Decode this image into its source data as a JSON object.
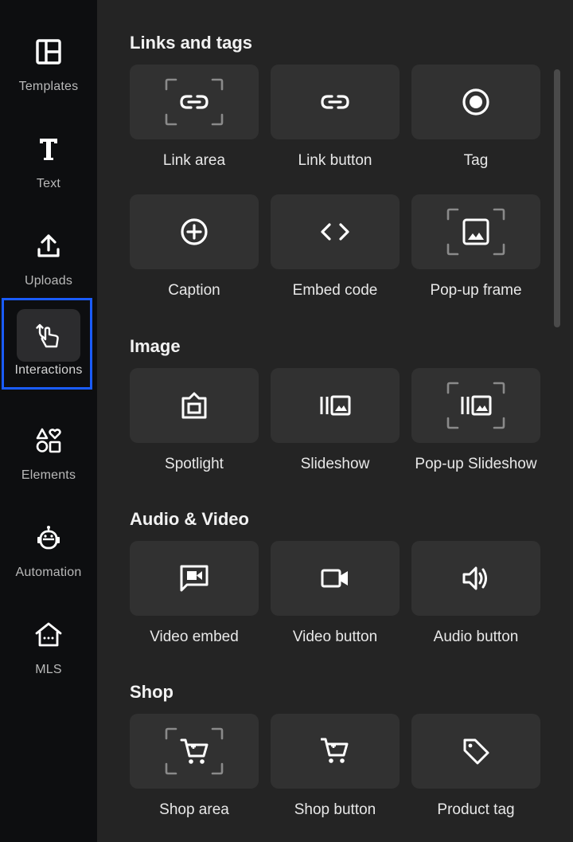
{
  "sidebar": {
    "items": [
      {
        "label": "Templates",
        "icon": "templates-icon"
      },
      {
        "label": "Text",
        "icon": "text-icon"
      },
      {
        "label": "Uploads",
        "icon": "upload-icon"
      },
      {
        "label": "Interactions",
        "icon": "interactions-icon",
        "active": true
      },
      {
        "label": "Elements",
        "icon": "elements-icon"
      },
      {
        "label": "Automation",
        "icon": "robot-icon"
      },
      {
        "label": "MLS",
        "icon": "house-icon"
      }
    ]
  },
  "sections": [
    {
      "title": "Links and tags",
      "items": [
        {
          "label": "Link area",
          "icon": "link-area-icon"
        },
        {
          "label": "Link button",
          "icon": "link-icon"
        },
        {
          "label": "Tag",
          "icon": "tag-dot-icon"
        },
        {
          "label": "Caption",
          "icon": "plus-circle-icon"
        },
        {
          "label": "Embed code",
          "icon": "code-icon"
        },
        {
          "label": "Pop-up frame",
          "icon": "popup-frame-icon"
        }
      ]
    },
    {
      "title": "Image",
      "items": [
        {
          "label": "Spotlight",
          "icon": "spotlight-icon"
        },
        {
          "label": "Slideshow",
          "icon": "slideshow-icon"
        },
        {
          "label": "Pop-up Slideshow",
          "icon": "popup-slideshow-icon"
        }
      ]
    },
    {
      "title": "Audio & Video",
      "items": [
        {
          "label": "Video embed",
          "icon": "video-embed-icon"
        },
        {
          "label": "Video button",
          "icon": "video-camera-icon"
        },
        {
          "label": "Audio button",
          "icon": "speaker-icon"
        }
      ]
    },
    {
      "title": "Shop",
      "items": [
        {
          "label": "Shop area",
          "icon": "shop-area-icon"
        },
        {
          "label": "Shop button",
          "icon": "cart-icon"
        },
        {
          "label": "Product tag",
          "icon": "price-tag-icon"
        }
      ]
    }
  ],
  "colors": {
    "active_outline": "#1a5cff",
    "tile": "#313131",
    "sidebar": "#0d0e10",
    "panel": "#242424"
  }
}
